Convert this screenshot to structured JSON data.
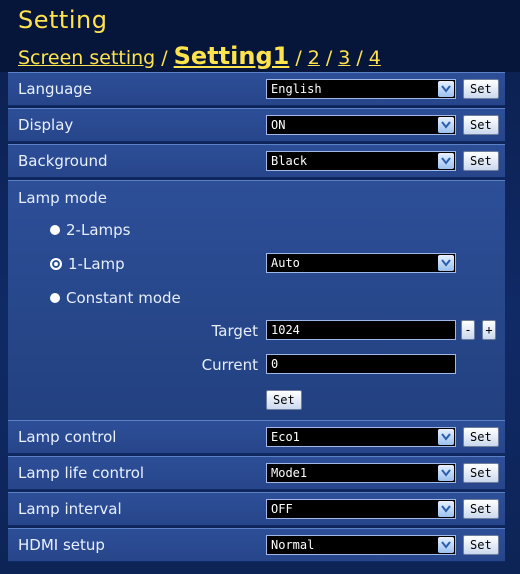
{
  "header": {
    "title": "Setting",
    "breadcrumb": {
      "screen_setting": "Screen setting",
      "sep": "/",
      "current": "Setting1",
      "p2": "2",
      "p3": "3",
      "p4": "4"
    }
  },
  "rows": {
    "language": {
      "label": "Language",
      "value": "English",
      "set": "Set"
    },
    "display": {
      "label": "Display",
      "value": "ON",
      "set": "Set"
    },
    "background": {
      "label": "Background",
      "value": "Black",
      "set": "Set"
    },
    "lamp_control": {
      "label": "Lamp control",
      "value": "Eco1",
      "set": "Set"
    },
    "lamp_life_control": {
      "label": "Lamp life control",
      "value": "Mode1",
      "set": "Set"
    },
    "lamp_interval": {
      "label": "Lamp interval",
      "value": "OFF",
      "set": "Set"
    },
    "hdmi_setup": {
      "label": "HDMI setup",
      "value": "Normal",
      "set": "Set"
    }
  },
  "lamp_mode": {
    "title": "Lamp mode",
    "options": [
      {
        "label": "2-Lamps",
        "selected": false
      },
      {
        "label": "1-Lamp",
        "selected": true
      },
      {
        "label": "Constant mode",
        "selected": false
      }
    ],
    "one_lamp_value": "Auto",
    "target_label": "Target",
    "target_value": "1024",
    "current_label": "Current",
    "current_value": "0",
    "minus": "-",
    "plus": "+",
    "set": "Set"
  }
}
